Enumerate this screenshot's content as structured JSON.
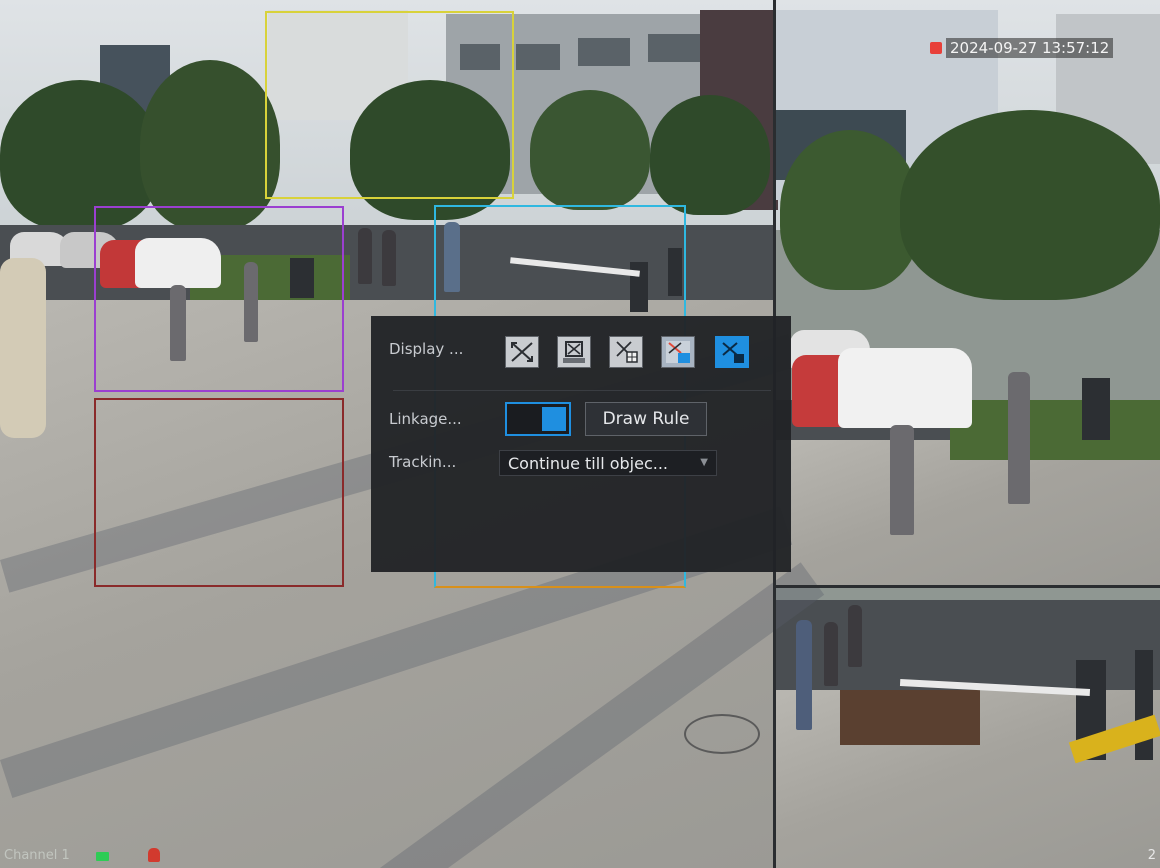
{
  "overlay": {
    "timestamp": "2024-09-27 13:57:12",
    "camera_name": "Channel 1",
    "channel_number": "2",
    "colors": {
      "accent": "#1f8fe0",
      "rule_yellow": "#d8d23a",
      "rule_purple": "#9b3fd0",
      "rule_red": "#8a2a2a",
      "rule_cyan": "#2fb8e0",
      "rule_orange": "#d8901a",
      "recording": "#2ecc55",
      "alarm": "#d23a2e"
    }
  },
  "panel": {
    "display_label": "Display ...",
    "display_modes": [
      {
        "icon": "display-mode-1-icon",
        "active": false
      },
      {
        "icon": "display-mode-2-icon",
        "active": false
      },
      {
        "icon": "display-mode-3-icon",
        "active": false
      },
      {
        "icon": "display-mode-4-icon",
        "active": false
      },
      {
        "icon": "display-mode-5-icon",
        "active": true
      }
    ],
    "linkage_label": "Linkage...",
    "linkage_enabled": true,
    "draw_rule_label": "Draw Rule",
    "tracking_label": "Trackin...",
    "tracking_value": "Continue till objec..."
  }
}
